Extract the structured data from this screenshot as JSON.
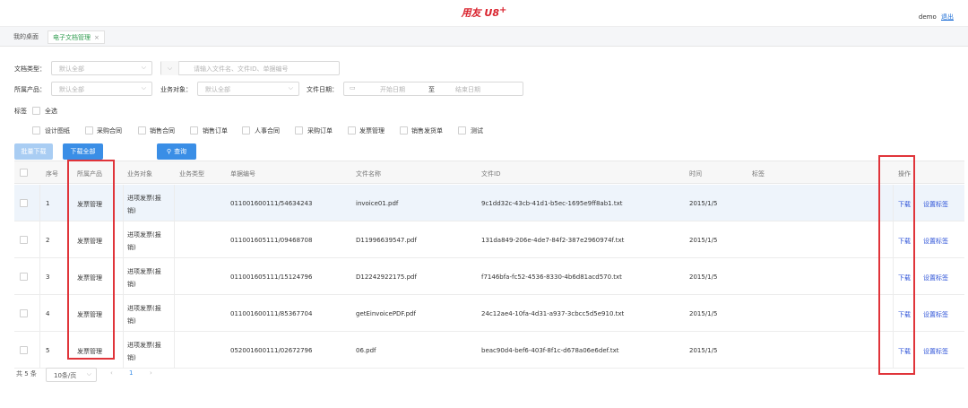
{
  "app": {
    "logo_text": "用友 U8",
    "logo_plus": "+"
  },
  "user": {
    "name": "demo",
    "logout": "退出"
  },
  "tabs": {
    "home": "我的桌面",
    "active": "电子文档管理",
    "close": "×"
  },
  "filters": {
    "doc_type_label": "文档类型：",
    "doc_type_value": "默认全部",
    "search_placeholder": "请输入文件名、文件ID、单据编号",
    "product_label": "所属产品：",
    "product_value": "默认全部",
    "biz_label": "业务对象：",
    "biz_value": "默认全部",
    "date_label": "文件日期：",
    "date_start": "开始日期",
    "date_sep": "至",
    "date_end": "结束日期",
    "tag_label": "标签",
    "select_all": "全选",
    "tags": [
      "设计图纸",
      "采购合同",
      "销售合同",
      "销售订单",
      "人事合同",
      "采购订单",
      "发票管理",
      "销售发货单",
      "测试"
    ]
  },
  "buttons": {
    "batch_download": "批量下载",
    "download_all": "下载全部",
    "query": "查询"
  },
  "table": {
    "headers": {
      "index": "序号",
      "product": "所属产品",
      "object": "业务对象",
      "type": "业务类型",
      "doc_no": "单据编号",
      "filename": "文件名称",
      "file_id": "文件ID",
      "time": "时间",
      "tag": "标签",
      "action": "操作"
    },
    "rows": [
      {
        "index": "1",
        "product": "发票管理",
        "object1": "进项发票(报",
        "object2": "销)",
        "doc_no": "011001600111/54634243",
        "filename": "invoice01.pdf",
        "file_id": "9c1dd32c-43cb-41d1-b5ec-1695e9ff8ab1.txt",
        "time": "2015/1/5",
        "download": "下载",
        "set_tag": "设置标签"
      },
      {
        "index": "2",
        "product": "发票管理",
        "object1": "进项发票(报",
        "object2": "销)",
        "doc_no": "011001605111/09468708",
        "filename": "D11996639547.pdf",
        "file_id": "131da849-206e-4de7-84f2-387e2960974f.txt",
        "time": "2015/1/5",
        "download": "下载",
        "set_tag": "设置标签"
      },
      {
        "index": "3",
        "product": "发票管理",
        "object1": "进项发票(报",
        "object2": "销)",
        "doc_no": "011001605111/15124796",
        "filename": "D12242922175.pdf",
        "file_id": "f7146bfa-fc52-4536-8330-4b6d81acd570.txt",
        "time": "2015/1/5",
        "download": "下载",
        "set_tag": "设置标签"
      },
      {
        "index": "4",
        "product": "发票管理",
        "object1": "进项发票(报",
        "object2": "销)",
        "doc_no": "011001600111/85367704",
        "filename": "getEinvoicePDF.pdf",
        "file_id": "24c12ae4-10fa-4d31-a937-3cbcc5d5e910.txt",
        "time": "2015/1/5",
        "download": "下载",
        "set_tag": "设置标签"
      },
      {
        "index": "5",
        "product": "发票管理",
        "object1": "进项发票(报",
        "object2": "销)",
        "doc_no": "052001600111/02672796",
        "filename": "06.pdf",
        "file_id": "beac90d4-bef6-403f-8f1c-d678a06e6def.txt",
        "time": "2015/1/5",
        "download": "下载",
        "set_tag": "设置标签"
      }
    ]
  },
  "pager": {
    "total": "共 5 条",
    "page_size": "10条/页",
    "prev": "‹",
    "page": "1",
    "next": "›"
  },
  "colors": {
    "accent": "#3a8ee6",
    "annotation": "#e0343a",
    "link": "#2f54d8"
  }
}
